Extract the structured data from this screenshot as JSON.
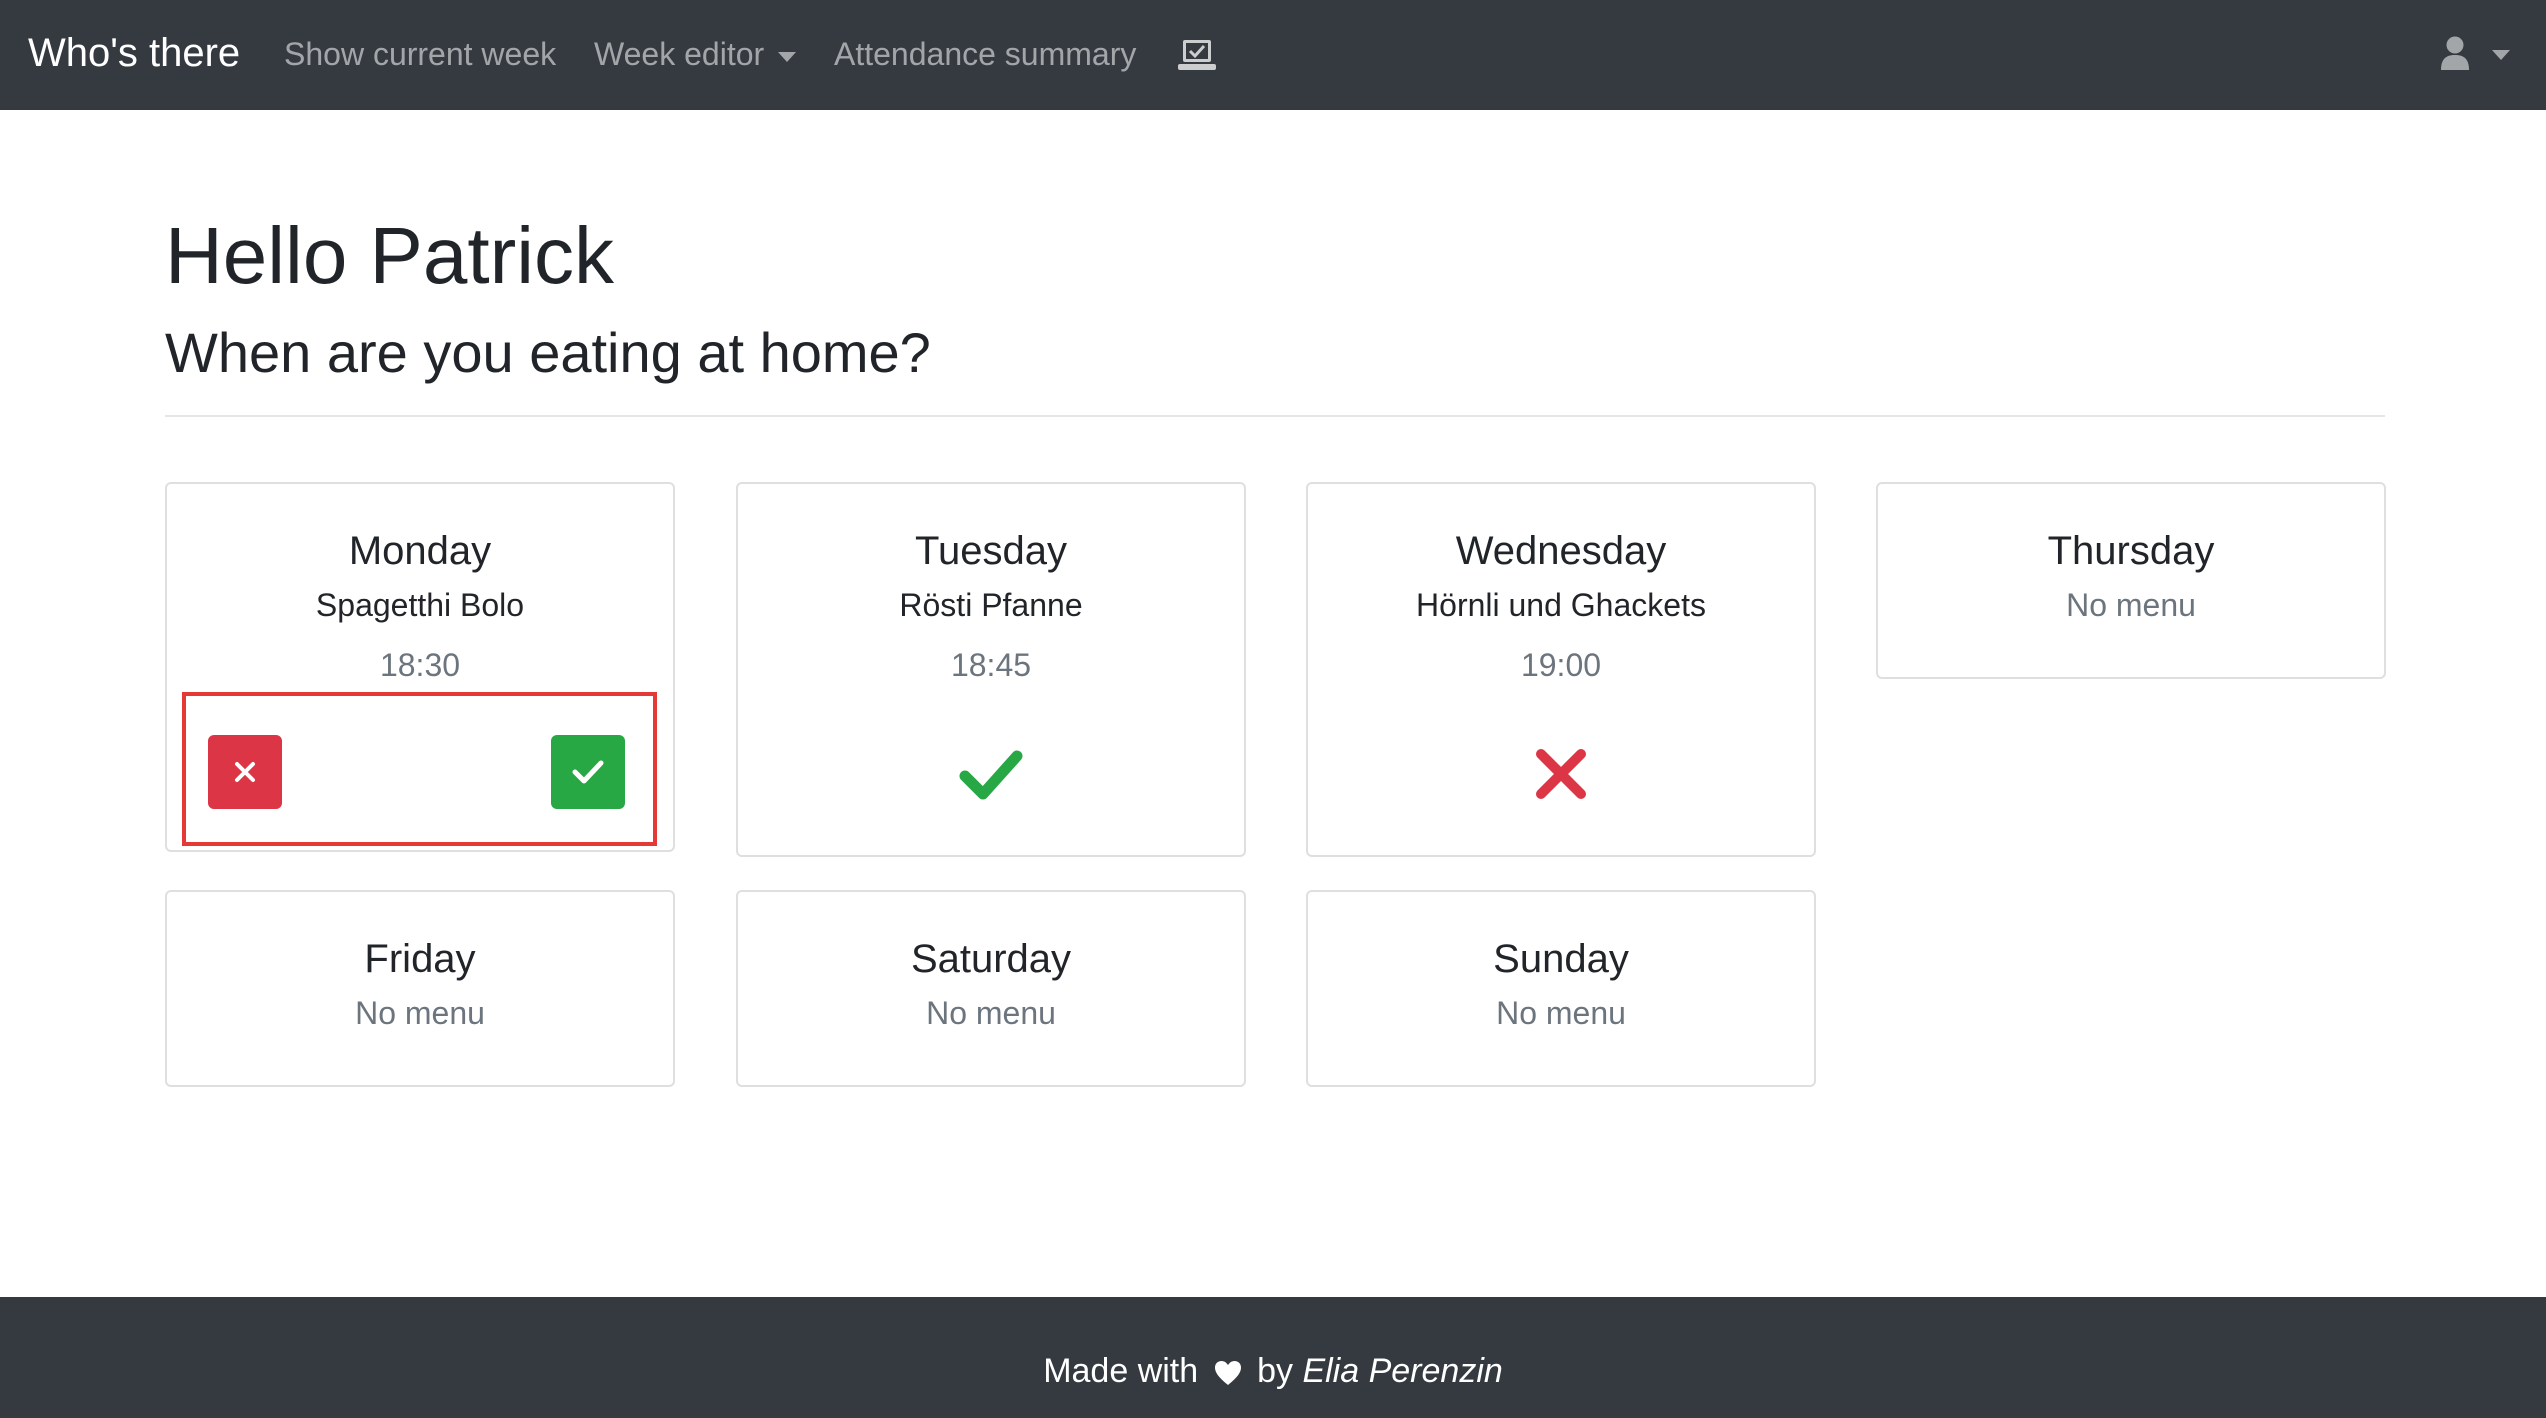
{
  "navbar": {
    "brand": "Who's there",
    "links": [
      "Show current week",
      "Week editor",
      "Attendance summary"
    ],
    "icons": [
      "attendance-laptop-icon",
      "user-icon"
    ]
  },
  "header": {
    "greeting": "Hello Patrick",
    "question": "When are you eating at home?"
  },
  "days": [
    {
      "day": "Monday",
      "menu": "Spagetthi Bolo",
      "time": "18:30",
      "status": "pending"
    },
    {
      "day": "Tuesday",
      "menu": "Rösti Pfanne",
      "time": "18:45",
      "status": "attending"
    },
    {
      "day": "Wednesday",
      "menu": "Hörnli und Ghackets",
      "time": "19:00",
      "status": "not-attending"
    },
    {
      "day": "Thursday",
      "menu": "No menu"
    },
    {
      "day": "Friday",
      "menu": "No menu"
    },
    {
      "day": "Saturday",
      "menu": "No menu"
    },
    {
      "day": "Sunday",
      "menu": "No menu"
    }
  ],
  "colors": {
    "navbar": "#343a40",
    "danger": "#dc3545",
    "success": "#28a745",
    "muted": "#6c757d",
    "highlight": "#e53935"
  },
  "footer": {
    "prefix": "Made with",
    "middle": "by",
    "author": "Elia Perenzin"
  }
}
